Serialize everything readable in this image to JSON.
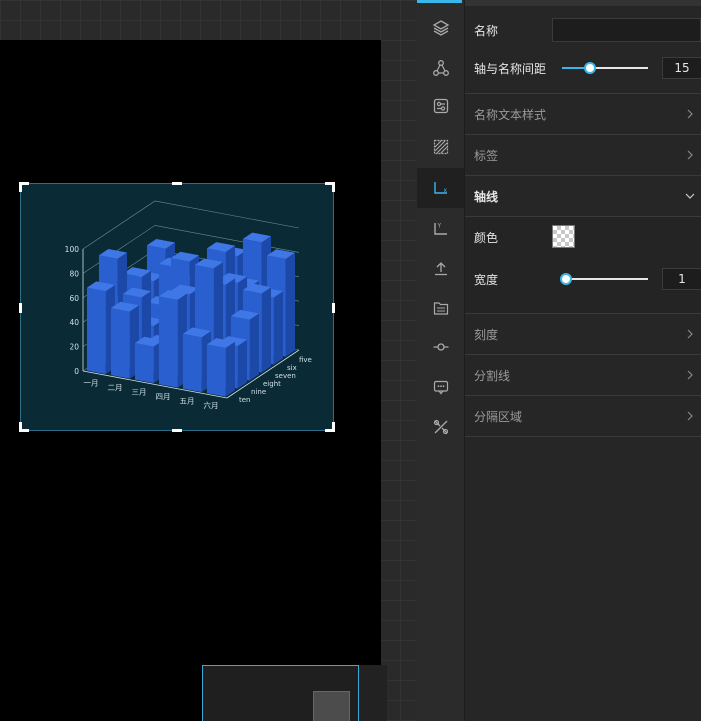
{
  "panel": {
    "name_label": "名称",
    "name_value": "",
    "gap_label": "轴与名称间距",
    "gap_value": 15,
    "gap_fraction": 0.33,
    "name_style_label": "名称文本样式",
    "tag_label": "标签",
    "axis_line_label": "轴线",
    "color_label": "颜色",
    "width_label": "宽度",
    "width_value": 1,
    "width_fraction": 0.0,
    "tick_label": "刻度",
    "split_line_label": "分割线",
    "split_area_label": "分隔区域"
  },
  "rail": {
    "icons": [
      "layers-icon",
      "nodes-icon",
      "settings-icon",
      "grid-hatch-icon",
      "x-axis-icon",
      "y-axis-icon",
      "upload-icon",
      "list-icon",
      "timeline-icon",
      "tooltip-icon",
      "tools-icon"
    ],
    "active": "x-axis-icon"
  },
  "colors": {
    "accent": "#3bb6ea",
    "bar": "#2a5fd0",
    "chart_bg": "#0a2a35"
  },
  "chart_data": {
    "type": "bar3d",
    "x_categories": [
      "一月",
      "二月",
      "三月",
      "四月",
      "五月",
      "六月"
    ],
    "y_categories": [
      "ten",
      "nine",
      "eight",
      "seven",
      "six",
      "five"
    ],
    "z_ticks": [
      "0",
      "20",
      "40",
      "60",
      "80",
      "100"
    ],
    "zlim": [
      0,
      100
    ],
    "series": [
      {
        "values": [
          [
            68,
            55,
            30,
            72,
            45,
            40
          ],
          [
            88,
            60,
            25,
            70,
            95,
            35
          ],
          [
            45,
            30,
            55,
            60,
            75,
            50
          ],
          [
            60,
            40,
            80,
            50,
            70,
            65
          ],
          [
            50,
            65,
            40,
            85,
            60,
            55
          ],
          [
            70,
            45,
            60,
            75,
            90,
            80
          ]
        ]
      }
    ]
  }
}
